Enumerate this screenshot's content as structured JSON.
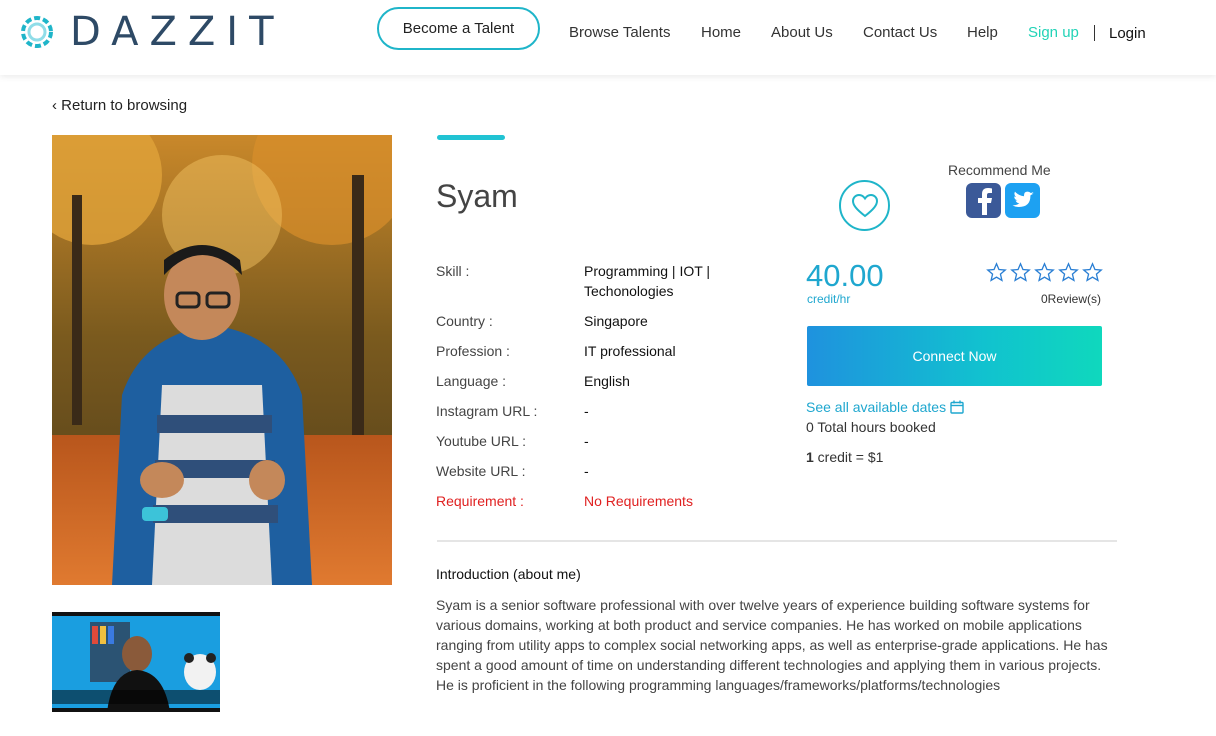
{
  "brand": {
    "name": "DAZZIT"
  },
  "nav": {
    "become_talent": "Become a Talent",
    "browse_talents": "Browse Talents",
    "home": "Home",
    "about": "About Us",
    "contact": "Contact Us",
    "help": "Help",
    "signup": "Sign up",
    "login": "Login"
  },
  "back_link": "‹ Return to browsing",
  "profile": {
    "name": "Syam",
    "fields": [
      {
        "label": "Skill :",
        "value": "Programming | IOT | Techonologies"
      },
      {
        "label": "Country :",
        "value": "Singapore"
      },
      {
        "label": "Profession :",
        "value": "IT professional"
      },
      {
        "label": "Language :",
        "value": "English"
      },
      {
        "label": "Instagram URL :",
        "value": "-"
      },
      {
        "label": "Youtube URL :",
        "value": "-"
      },
      {
        "label": "Website URL :",
        "value": "-"
      },
      {
        "label": "Requirement :",
        "value": "No Requirements"
      }
    ]
  },
  "recommend": {
    "title": "Recommend Me",
    "icons": [
      "facebook-icon",
      "twitter-icon"
    ]
  },
  "pricing": {
    "price": "40.00",
    "unit": "credit/hr",
    "rating_stars": 0,
    "reviews": "0Review(s)",
    "connect_label": "Connect Now",
    "dates_link": "See all available dates",
    "hours_booked": "0 Total hours booked",
    "credit_amount": "1",
    "credit_rate": " credit = $1"
  },
  "intro": {
    "title": "Introduction (about me)",
    "body": "Syam is a senior software professional with over twelve years of experience building software systems for various domains, working at both product and service companies. He has worked on mobile applications ranging from utility apps to complex social networking apps, as well as enterprise-grade applications. He has spent a good amount of time on understanding different technologies and applying them in various projects. He is proficient in the following programming languages/frameworks/platforms/technologies"
  },
  "colors": {
    "accent": "#1fb5c9",
    "signup": "#22d3b7",
    "requirement": "#e02020",
    "price": "#1fa7cf"
  }
}
